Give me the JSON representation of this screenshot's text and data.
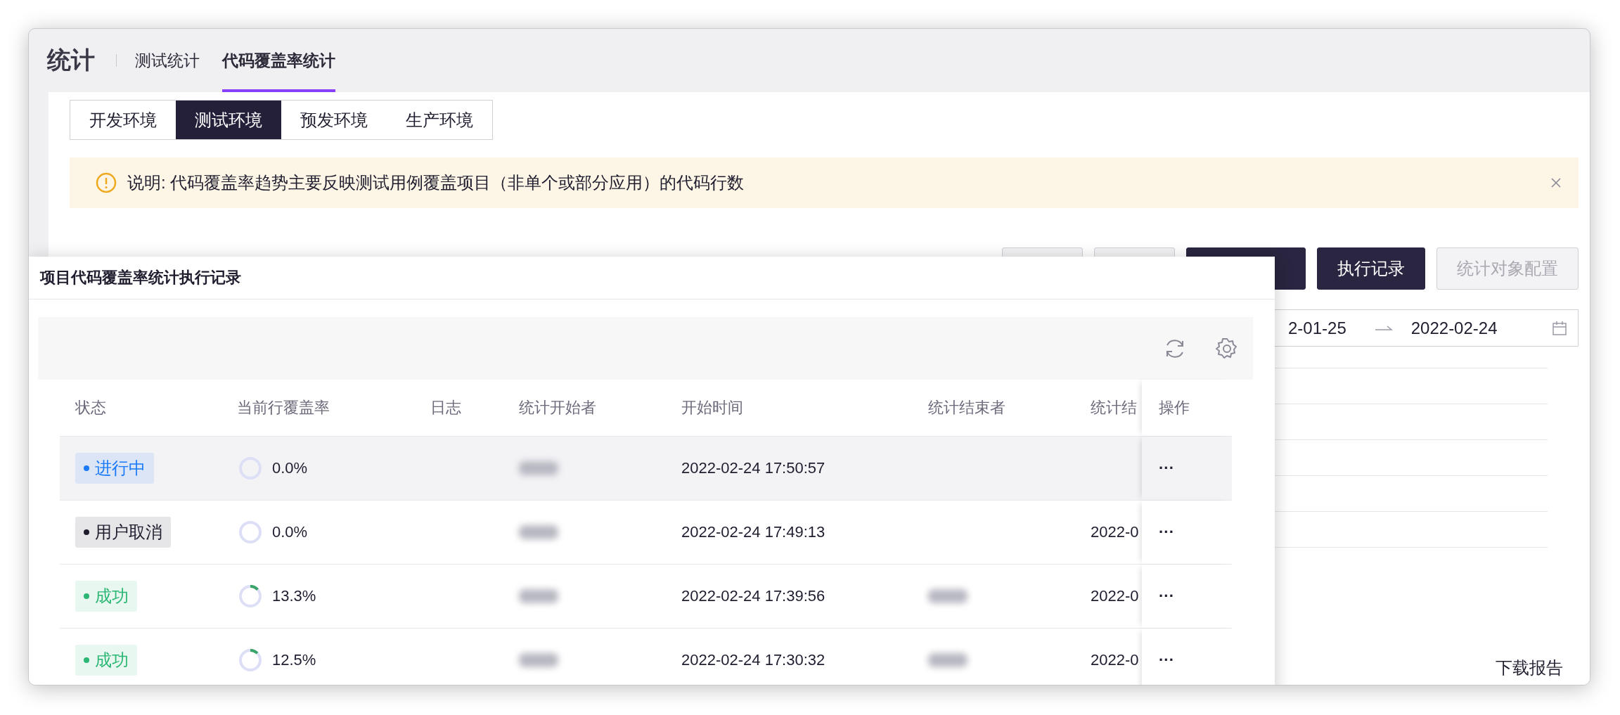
{
  "header": {
    "title": "统计",
    "tabs": [
      {
        "label": "测试统计",
        "selected": false
      },
      {
        "label": "代码覆盖率统计",
        "selected": true
      }
    ]
  },
  "environment_tabs": [
    {
      "label": "开发环境",
      "selected": false
    },
    {
      "label": "测试环境",
      "selected": true
    },
    {
      "label": "预发环境",
      "selected": false
    },
    {
      "label": "生产环境",
      "selected": false
    }
  ],
  "notice": {
    "text": "说明: 代码覆盖率趋势主要反映测试用例覆盖项目（非单个或部分应用）的代码行数"
  },
  "actions": [
    {
      "kind": "default"
    },
    {
      "kind": "default"
    },
    {
      "kind": "primary"
    },
    {
      "label": "执行记录",
      "kind": "primary",
      "disabled": false
    },
    {
      "label": "统计对象配置",
      "kind": "default",
      "disabled": true
    }
  ],
  "date_range": {
    "start": "2-01-25",
    "end": "2022-02-24"
  },
  "download_link": "下载报告",
  "popover": {
    "title": "项目代码覆盖率统计执行记录",
    "columns": [
      "状态",
      "当前行覆盖率",
      "日志",
      "统计开始者",
      "开始时间",
      "统计结束者",
      "统计结",
      "操作"
    ],
    "rows": [
      {
        "status": "进行中",
        "color": "#1a7af8",
        "coverage": "0.0%",
        "level": 0,
        "start_time": "2022-02-24 17:50:57",
        "ended_by_blurred": false,
        "highlighted": true,
        "menu": "···"
      },
      {
        "status": "用户取消",
        "color": "#1f1c2e",
        "coverage": "0.0%",
        "level": 0,
        "start_time": "2022-02-24 17:49:13",
        "end_time": "2022-0",
        "ended_by_blurred": false,
        "highlighted": false,
        "menu": "···"
      },
      {
        "status": "成功",
        "color": "#2bb673",
        "coverage": "13.3%",
        "level": 0.133,
        "start_time": "2022-02-24 17:39:56",
        "end_time": "2022-0",
        "ended_by_blurred": true,
        "highlighted": false,
        "menu": "···"
      },
      {
        "status": "成功",
        "color": "#2bb673",
        "coverage": "12.5%",
        "level": 0.125,
        "start_time": "2022-02-24 17:30:32",
        "end_time": "2022-0",
        "ended_by_blurred": true,
        "highlighted": false,
        "menu": "···"
      }
    ]
  }
}
